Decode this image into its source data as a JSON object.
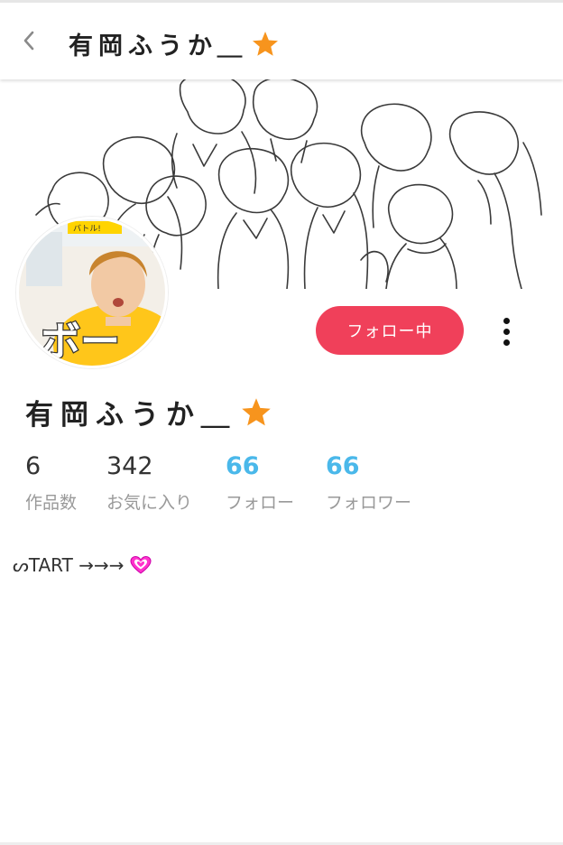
{
  "header": {
    "title": "有岡ふうか＿",
    "back_icon": "chevron-left-icon",
    "title_icon": "star-icon"
  },
  "cover": {
    "kind": "line-drawing illustration of a group of people"
  },
  "avatar": {
    "caption": "ボー",
    "overlay_text_small": "バトル!"
  },
  "actions": {
    "follow_label": "フォロー中",
    "more_icon": "more-vertical-icon"
  },
  "profile": {
    "display_name": "有岡ふうか＿",
    "name_icon": "star-icon"
  },
  "stats": [
    {
      "value": "6",
      "label": "作品数"
    },
    {
      "value": "342",
      "label": "お気に入り"
    },
    {
      "value": "66",
      "label": "フォロー"
    },
    {
      "value": "66",
      "label": "フォロワー"
    }
  ],
  "bio": {
    "text": "ᔕTART →→→",
    "icon": "heart-icon"
  },
  "colors": {
    "accent": "#f0405a",
    "link": "#4ab8ea",
    "star": "#f7941d",
    "heart": "#ff33cc",
    "muted": "#999999"
  }
}
